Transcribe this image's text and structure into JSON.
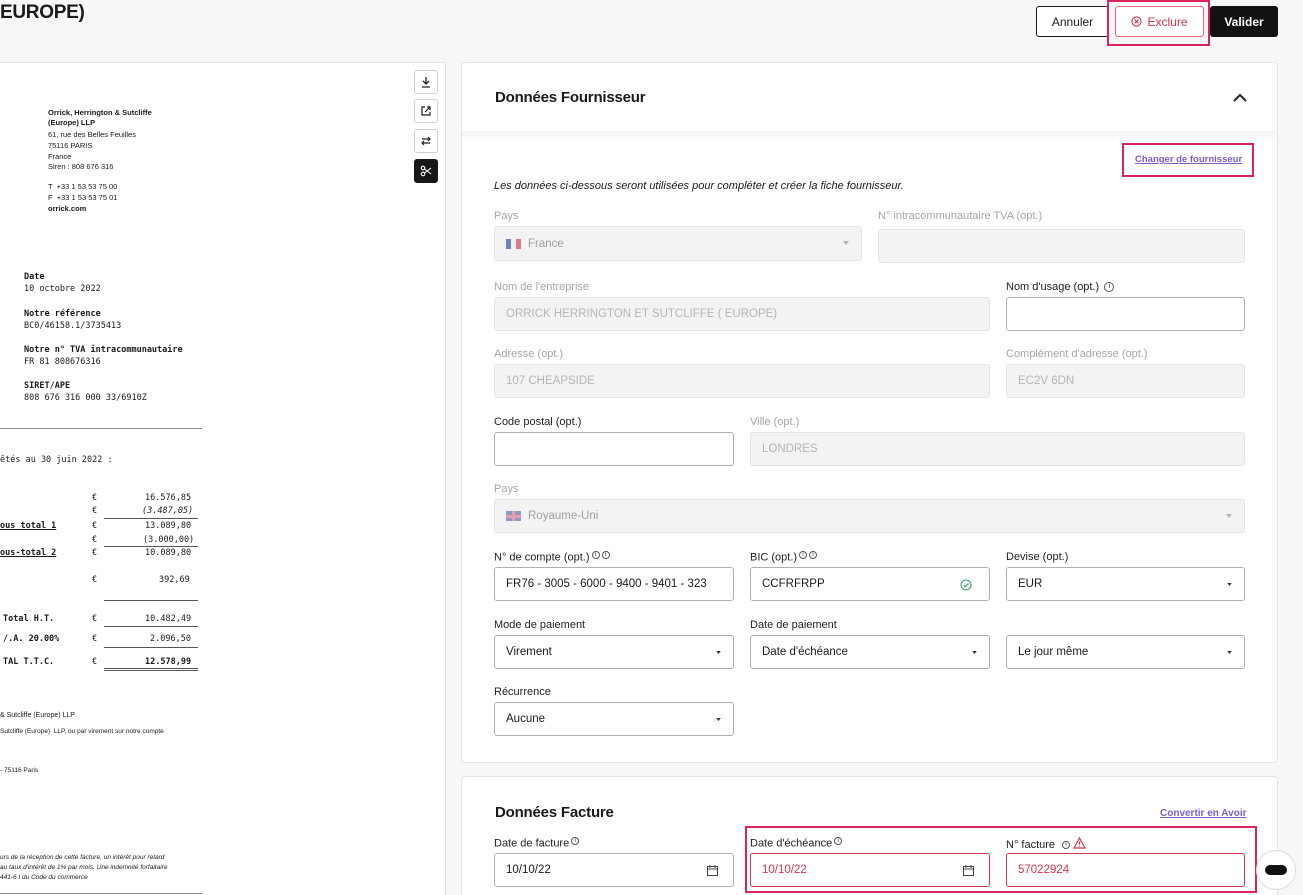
{
  "header": {
    "title": "EUROPE)",
    "annuler_label": "Annuler",
    "exclure_label": "Exclure",
    "valider_label": "Valider"
  },
  "document": {
    "sender": [
      "Orrick, Herrington & Sutcliffe",
      "(Europe) LLP",
      "61, rue des Belles Feuilles",
      "75116 PARIS",
      "France",
      "Siren : 808 676 316"
    ],
    "tel": "T  +33 1 53 53 75 00",
    "fax": "F  +33 1 53 53 75 01",
    "web": "orrick.com",
    "date_label": "Date",
    "date_value": "10 octobre 2022",
    "ref_label": "Notre référence",
    "ref_value": "BC0/46158.1/3735413",
    "tva_label": "Notre n° TVA intracommunautaire",
    "tva_value": "FR 81 808676316",
    "siret_label": "SIRET/APE",
    "siret_value": "808 676 316 000 33/6910Z",
    "period": "êtés au 30 juin 2022 :",
    "currency": "€",
    "rows": [
      {
        "label": "",
        "amount": "16.576,85"
      },
      {
        "label": "",
        "amount": "(3.487,05)"
      },
      {
        "label": "ous total 1",
        "amount": "13.089,80"
      },
      {
        "label": "",
        "amount": "(3.000,00)"
      },
      {
        "label": "ous-total 2",
        "amount": "10.089,80"
      },
      {
        "label": "",
        "amount": "392,69"
      },
      {
        "label": "Total H.T.",
        "amount": "10.482,49"
      },
      {
        "label": "/.A. 20.00%",
        "amount": "2.096,50"
      },
      {
        "label": "TAL T.T.C.",
        "amount": "12.578,99"
      }
    ],
    "footer1": "& Sutcliffe (Europe) LLP",
    "footer2": "Sutcliffe (Europe)  LLP, ou par virement sur notre compte",
    "footer3": "- 75116 Paris",
    "footer4": "urs de la réception de cette facture, un intérêt pour retard",
    "footer5": "au taux d'intérêt de 1% par mois. Une indemnité forfaitaire",
    "footer6": "441-6 I du Code du commerce"
  },
  "supplier": {
    "title": "Données Fournisseur",
    "change_link": "Changer de fournisseur",
    "note": "Les données ci-dessous seront utilisées pour compléter et créer la fiche fournisseur.",
    "pays_label": "Pays",
    "pays_value": "France",
    "tva_label": "N° intracommunautaire TVA (opt.)",
    "tva_value": "",
    "company_label": "Nom de l'entreprise",
    "company_value": "ORRICK HERRINGTON ET SUTCLIFFE ( EUROPE)",
    "usage_label": "Nom d'usage (opt.)",
    "usage_value": "",
    "address_label": "Adresse (opt.)",
    "address_value": "107 CHEAPSIDE",
    "address2_label": "Complément d'adresse (opt.)",
    "address2_value": "EC2V 6DN",
    "postal_label": "Code postal (opt.)",
    "postal_value": "",
    "city_label": "Ville (opt.)",
    "city_value": "LONDRES",
    "pays2_label": "Pays",
    "pays2_value": "Royaume-Uni",
    "account_label": "N° de compte (opt.)",
    "account_value": "FR76 - 3005 - 6000 - 9400 - 9401 - 323",
    "bic_label": "BIC (opt.)",
    "bic_value": "CCFRFRPP",
    "devise_label": "Devise (opt.)",
    "devise_value": "EUR",
    "mode_label": "Mode de paiement",
    "mode_value": "Virement",
    "date_pay_label": "Date de paiement",
    "date_pay_value": "Date d'échéance",
    "date_pay_value2": "Le jour même",
    "recurrence_label": "Récurrence",
    "recurrence_value": "Aucune"
  },
  "invoice": {
    "title": "Données Facture",
    "convert_link": "Convertir en Avoir",
    "date_label": "Date de facture",
    "date_value": "10/10/22",
    "due_label": "Date d'échéance",
    "due_value": "10/10/22",
    "number_label": "N° facture",
    "number_value": "57022924"
  },
  "colors": {
    "accent": "#d8235b",
    "error": "#d6334d",
    "link": "#7b5cc9",
    "primary": "#121212"
  }
}
